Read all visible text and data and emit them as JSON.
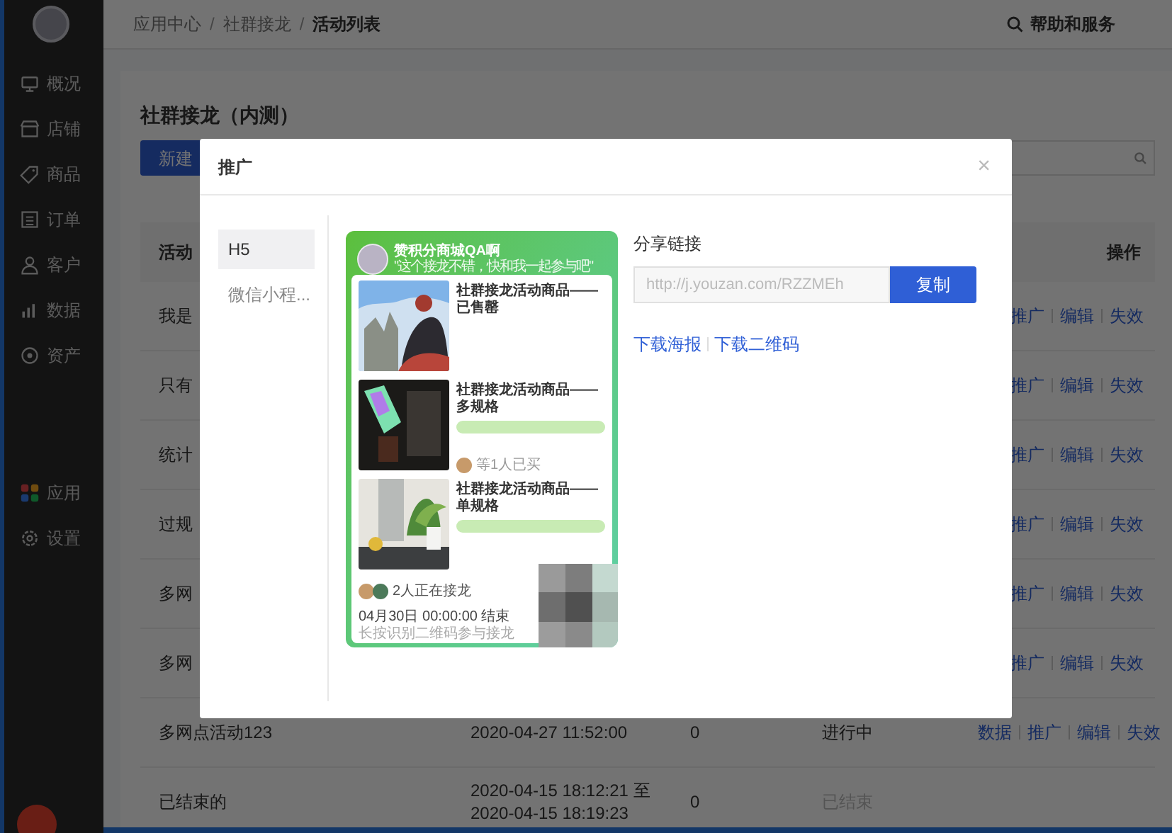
{
  "sidebar": {
    "items": [
      {
        "label": "概况"
      },
      {
        "label": "店铺"
      },
      {
        "label": "商品"
      },
      {
        "label": "订单"
      },
      {
        "label": "客户"
      },
      {
        "label": "数据"
      },
      {
        "label": "资产"
      }
    ],
    "bottom_items": [
      {
        "label": "应用"
      },
      {
        "label": "设置"
      }
    ]
  },
  "breadcrumb": [
    {
      "text": "应用中心",
      "kind": "link"
    },
    {
      "text": "/",
      "kind": "separator"
    },
    {
      "text": "社群接龙",
      "kind": "link"
    },
    {
      "text": "/",
      "kind": "separator"
    },
    {
      "text": "活动列表",
      "kind": "current"
    }
  ],
  "help": "帮助和服务",
  "page_title": "社群接龙（内测）",
  "new_button": "新建",
  "table": {
    "columns": [
      "活动",
      "操作"
    ],
    "rows": [
      {
        "name": "我是",
        "actions": [
          "推广",
          "编辑",
          "失效"
        ]
      },
      {
        "name": "只有",
        "actions": [
          "推广",
          "编辑",
          "失效"
        ]
      },
      {
        "name": "统计",
        "actions": [
          "推广",
          "编辑",
          "失效"
        ]
      },
      {
        "name": "过规",
        "actions": [
          "推广",
          "编辑",
          "失效"
        ]
      },
      {
        "name": "多网",
        "actions": [
          "推广",
          "编辑",
          "失效"
        ]
      },
      {
        "name": "多网",
        "actions": [
          "推广",
          "编辑",
          "失效"
        ]
      },
      {
        "name": "多网点活动123",
        "time": [
          "2020-04-27 11:52:00"
        ],
        "count": "0",
        "status": "进行中",
        "ended": false,
        "actions": [
          "数据",
          "推广",
          "编辑",
          "失效"
        ]
      },
      {
        "name": "已结束的",
        "time": [
          "2020-04-15 18:12:21 至",
          "2020-04-15 18:19:23"
        ],
        "count": "0",
        "status": "已结束",
        "ended": true,
        "actions": []
      }
    ]
  },
  "modal": {
    "title": "推广",
    "close": "×",
    "tabs": [
      {
        "label": "H5",
        "selected": true
      },
      {
        "label": "微信小程...",
        "selected": false
      }
    ],
    "poster": {
      "shop_name": "赞积分商城QA啊",
      "slogan": "\"这个接龙不错，快和我一起参与吧\"",
      "products": [
        {
          "title": "社群接龙活动商品——已售罄",
          "kind": "sold_out"
        },
        {
          "title": "社群接龙活动商品——多规格",
          "kind": "spec",
          "buyers": "等1人已买"
        },
        {
          "title": "社群接龙活动商品——单规格",
          "kind": "spec"
        }
      ],
      "participants": "2人正在接龙",
      "end_time": "04月30日 00:00:00 结束",
      "hint": "长按识别二维码参与接龙"
    },
    "share_label": "分享链接",
    "link": "http://j.youzan.com/RZZMEh",
    "copy_button": "复制",
    "links": [
      "下载海报",
      "下载二维码"
    ]
  }
}
